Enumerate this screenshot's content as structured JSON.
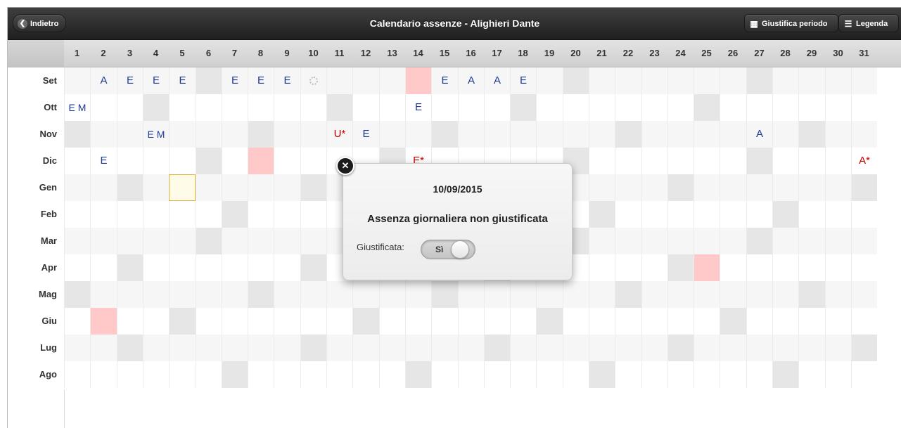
{
  "header": {
    "title": "Calendario assenze - Alighieri Dante",
    "back_label": "Indietro",
    "justify_label": "Giustifica periodo",
    "legend_label": "Legenda"
  },
  "days": [
    "1",
    "2",
    "3",
    "4",
    "5",
    "6",
    "7",
    "8",
    "9",
    "10",
    "11",
    "12",
    "13",
    "14",
    "15",
    "16",
    "17",
    "18",
    "19",
    "20",
    "21",
    "22",
    "23",
    "24",
    "25",
    "26",
    "27",
    "28",
    "29",
    "30",
    "31"
  ],
  "months": [
    {
      "name": "Set",
      "marks": {
        "2": "A",
        "3": "E",
        "4": "E",
        "5": "E",
        "7": "E",
        "8": "E",
        "9": "E",
        "15": "E",
        "16": "A",
        "17": "A",
        "18": "E"
      },
      "red": {},
      "weekend": [
        6,
        20,
        27
      ],
      "holiday": [
        14
      ],
      "spinner": [
        10
      ]
    },
    {
      "name": "Ott",
      "marks": {
        "1": "E M",
        "14": "E"
      },
      "red": {},
      "weekend": [
        4,
        11,
        18,
        25
      ]
    },
    {
      "name": "Nov",
      "marks": {
        "4": "E M",
        "12": "E",
        "27": "A"
      },
      "red": {
        "11": "U*"
      },
      "weekend": [
        1,
        8,
        15,
        22,
        29
      ]
    },
    {
      "name": "Dic",
      "marks": {
        "2": "E"
      },
      "red": {
        "14": "E*",
        "31": "A*"
      },
      "weekend": [
        6,
        13,
        20,
        27
      ],
      "holiday": [
        8
      ]
    },
    {
      "name": "Gen",
      "marks": {},
      "red": {},
      "weekend": [
        3,
        10,
        17,
        24,
        31
      ],
      "selected": [
        5
      ]
    },
    {
      "name": "Feb",
      "marks": {},
      "red": {},
      "weekend": [
        7,
        14,
        21,
        28
      ]
    },
    {
      "name": "Mar",
      "marks": {},
      "red": {},
      "weekend": [
        6,
        13,
        20,
        27
      ]
    },
    {
      "name": "Apr",
      "marks": {},
      "red": {},
      "weekend": [
        3,
        10,
        17,
        24
      ],
      "holiday": [
        25
      ]
    },
    {
      "name": "Mag",
      "marks": {},
      "red": {},
      "weekend": [
        1,
        8,
        15,
        22,
        29
      ]
    },
    {
      "name": "Giu",
      "marks": {},
      "red": {},
      "weekend": [
        5,
        12,
        19,
        26
      ],
      "holiday": [
        2
      ]
    },
    {
      "name": "Lug",
      "marks": {},
      "red": {},
      "weekend": [
        3,
        10,
        17,
        24,
        31
      ]
    },
    {
      "name": "Ago",
      "marks": {},
      "red": {},
      "weekend": [
        7,
        14,
        21,
        28
      ]
    }
  ],
  "popup": {
    "date": "10/09/2015",
    "description": "Assenza giornaliera non giustificata",
    "toggle_label": "Giustificata:",
    "toggle_value": "Sì"
  }
}
